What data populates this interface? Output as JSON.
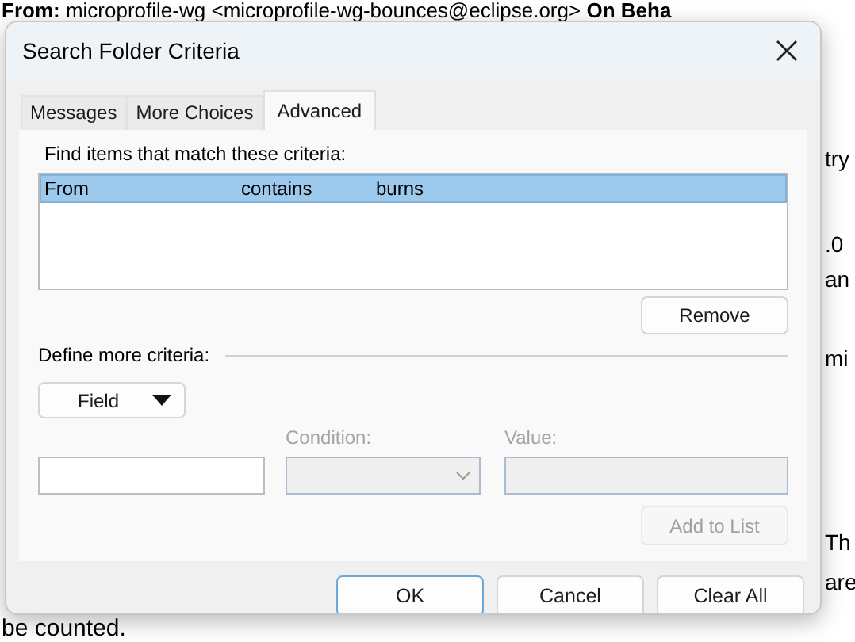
{
  "email": {
    "header": {
      "label": "From:",
      "sender": "microprofile-wg <",
      "address": "microprofile-wg-bounces@eclipse.org",
      "closing": ">",
      "behalf": "On Beha"
    },
    "right_edge_fragments": [
      "try",
      ".0",
      "an",
      "mi",
      "Th",
      "are"
    ],
    "bottom_line": "be counted."
  },
  "dialog": {
    "title": "Search Folder Criteria",
    "tabs": [
      {
        "label": "Messages",
        "selected": false
      },
      {
        "label": "More Choices",
        "selected": false
      },
      {
        "label": "Advanced",
        "selected": true
      }
    ],
    "criteria_label": "Find items that match these criteria:",
    "criteria": [
      {
        "field": "From",
        "condition": "contains",
        "value": "burns",
        "selected": true
      }
    ],
    "remove_button": {
      "label": "Remove",
      "disabled": false
    },
    "define_label": "Define more criteria:",
    "field_button": "Field",
    "condition": {
      "label": "Condition:",
      "disabled": true
    },
    "value": {
      "label": "Value:",
      "disabled": true
    },
    "add_button": {
      "label": "Add to List",
      "disabled": true
    },
    "buttons": [
      {
        "label": "OK",
        "default": true
      },
      {
        "label": "Cancel",
        "default": false
      },
      {
        "label": "Clear All",
        "default": false
      }
    ]
  }
}
